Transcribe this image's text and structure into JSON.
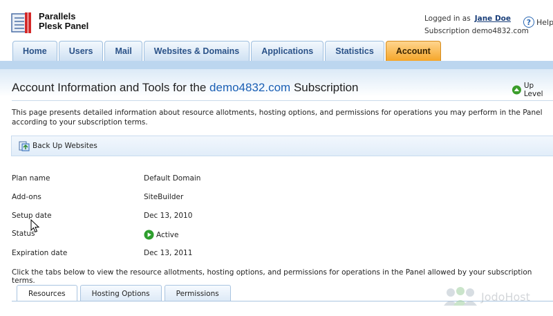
{
  "app": {
    "name_line1": "Parallels",
    "name_line2": "Plesk Panel"
  },
  "user": {
    "logged_in_label": "Logged in as",
    "name": "Jane Doe",
    "subscription_label": "Subscription demo4832.com"
  },
  "help": {
    "label": "Help"
  },
  "tabs": [
    {
      "label": "Home"
    },
    {
      "label": "Users"
    },
    {
      "label": "Mail"
    },
    {
      "label": "Websites & Domains"
    },
    {
      "label": "Applications"
    },
    {
      "label": "Statistics"
    },
    {
      "label": "Account",
      "active": true
    }
  ],
  "page": {
    "title_prefix": "Account Information and Tools for the",
    "title_link": "demo4832.com",
    "title_suffix": "Subscription",
    "up_level": "Up Level",
    "description": "This page presents detailed information about resource allotments, hosting options, and permissions for operations you may perform in the Panel according to your subscription terms."
  },
  "toolbar": {
    "backup_label": "Back Up Websites"
  },
  "details": [
    {
      "key": "Plan name",
      "value": "Default Domain"
    },
    {
      "key": "Add-ons",
      "value": "SiteBuilder"
    },
    {
      "key": "Setup date",
      "value": "Dec 13, 2010"
    },
    {
      "key": "Status",
      "value": "Active"
    },
    {
      "key": "Expiration date",
      "value": "Dec 13, 2011"
    }
  ],
  "hint": "Click the tabs below to view the resource allotments, hosting options, and permissions for operations in the Panel allowed by your subscription terms.",
  "subtabs": [
    {
      "label": "Resources",
      "active": true
    },
    {
      "label": "Hosting Options"
    },
    {
      "label": "Permissions"
    }
  ],
  "watermark": "JodoHost",
  "colors": {
    "accent_tab": "#f5a62a",
    "link": "#1a5fb4",
    "status_green": "#2e9e2e"
  }
}
